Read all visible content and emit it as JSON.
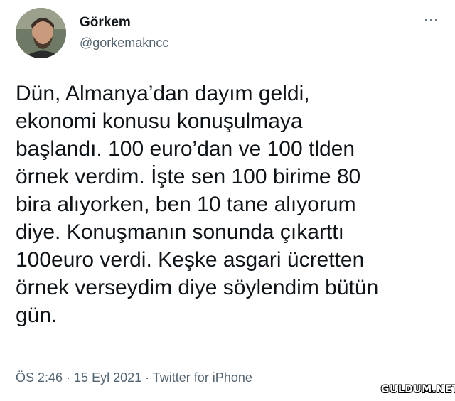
{
  "tweet": {
    "display_name": "Görkem",
    "handle": "@gorkemakncc",
    "more_icon": "more-horizontal-icon",
    "more_label": "···",
    "text": "Dün, Almanya’dan dayım geldi,\nekonomi konusu konuşulmaya\nbaşlandı. 100 euro’dan ve 100 tlden\nörnek verdim. İşte sen 100 birime 80\nbira alıyorken, ben 10 tane alıyorum\ndiye. Konuşmanın sonunda çıkarttı\n100euro verdi. Keşke asgari ücretten\nörnek verseydim diye söylendim bütün\ngün.",
    "time": "ÖS 2:46",
    "date": "15 Eyl 2021",
    "source": "Twitter for iPhone",
    "separator": " · "
  },
  "watermark": "GULDUM.NET",
  "colors": {
    "text": "#0f1419",
    "secondary": "#536471",
    "background": "#ffffff"
  }
}
